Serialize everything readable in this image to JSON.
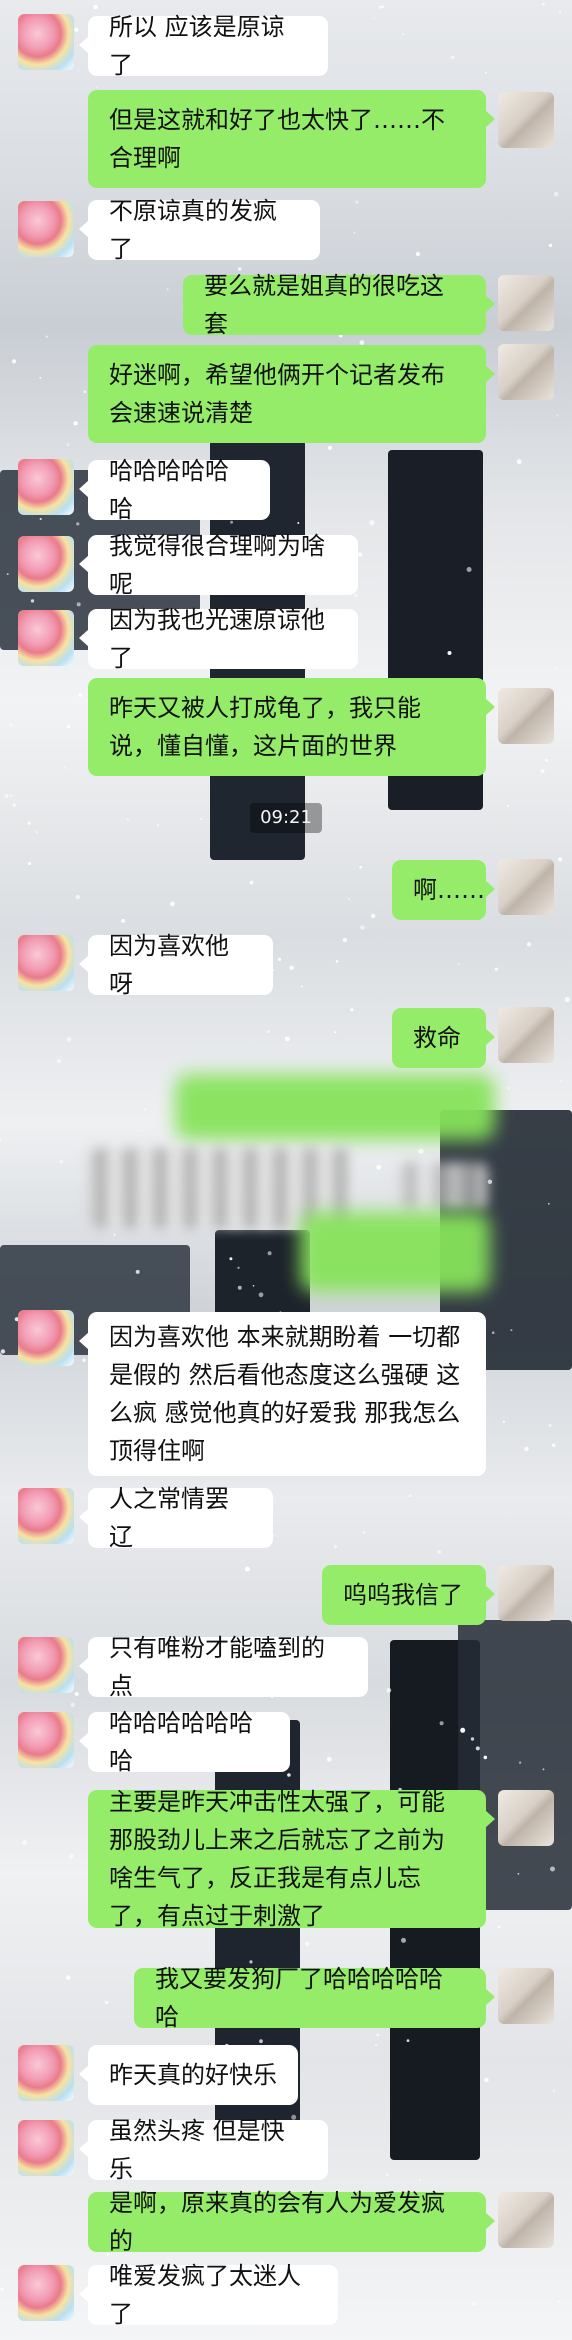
{
  "time_divider": "09:21",
  "messages": [
    {
      "side": "left",
      "text": "所以 应该是原谅了"
    },
    {
      "side": "right",
      "text": "但是这就和好了也太快了……不合理啊"
    },
    {
      "side": "left",
      "text": "不原谅真的发疯了"
    },
    {
      "side": "right",
      "text": "要么就是姐真的很吃这套"
    },
    {
      "side": "right",
      "text": "好迷啊，希望他俩开个记者发布会速速说清楚"
    },
    {
      "side": "left",
      "text": "哈哈哈哈哈哈"
    },
    {
      "side": "left",
      "text": "我觉得很合理啊为啥呢"
    },
    {
      "side": "left",
      "text": "因为我也光速原谅他了"
    },
    {
      "side": "right",
      "text": "昨天又被人打成龟了，我只能说，懂自懂，这片面的世界"
    },
    {
      "side": "right",
      "text": "啊……"
    },
    {
      "side": "left",
      "text": "因为喜欢他呀"
    },
    {
      "side": "right",
      "text": "救命"
    },
    {
      "side": "left",
      "text": "因为喜欢他 本来就期盼着 一切都是假的 然后看他态度这么强硬 这么疯 感觉他真的好爱我 那我怎么顶得住啊"
    },
    {
      "side": "left",
      "text": "人之常情罢辽"
    },
    {
      "side": "right",
      "text": "呜呜我信了"
    },
    {
      "side": "left",
      "text": "只有唯粉才能嗑到的点"
    },
    {
      "side": "left",
      "text": "哈哈哈哈哈哈哈"
    },
    {
      "side": "right",
      "text": "主要是昨天冲击性太强了，可能那股劲儿上来之后就忘了之前为啥生气了，反正我是有点儿忘了，有点过于刺激了"
    },
    {
      "side": "right",
      "text": "我又要发狗厂了哈哈哈哈哈哈"
    },
    {
      "side": "left",
      "text": "昨天真的好快乐"
    },
    {
      "side": "left",
      "text": "虽然头疼 但是快乐"
    },
    {
      "side": "right",
      "text": "是啊，原来真的会有人为爱发疯的"
    },
    {
      "side": "left",
      "text": "唯爱发疯了太迷人了"
    }
  ],
  "colors": {
    "outgoing_bubble": "#95ec69",
    "incoming_bubble": "#ffffff",
    "time_badge": "#595959"
  }
}
